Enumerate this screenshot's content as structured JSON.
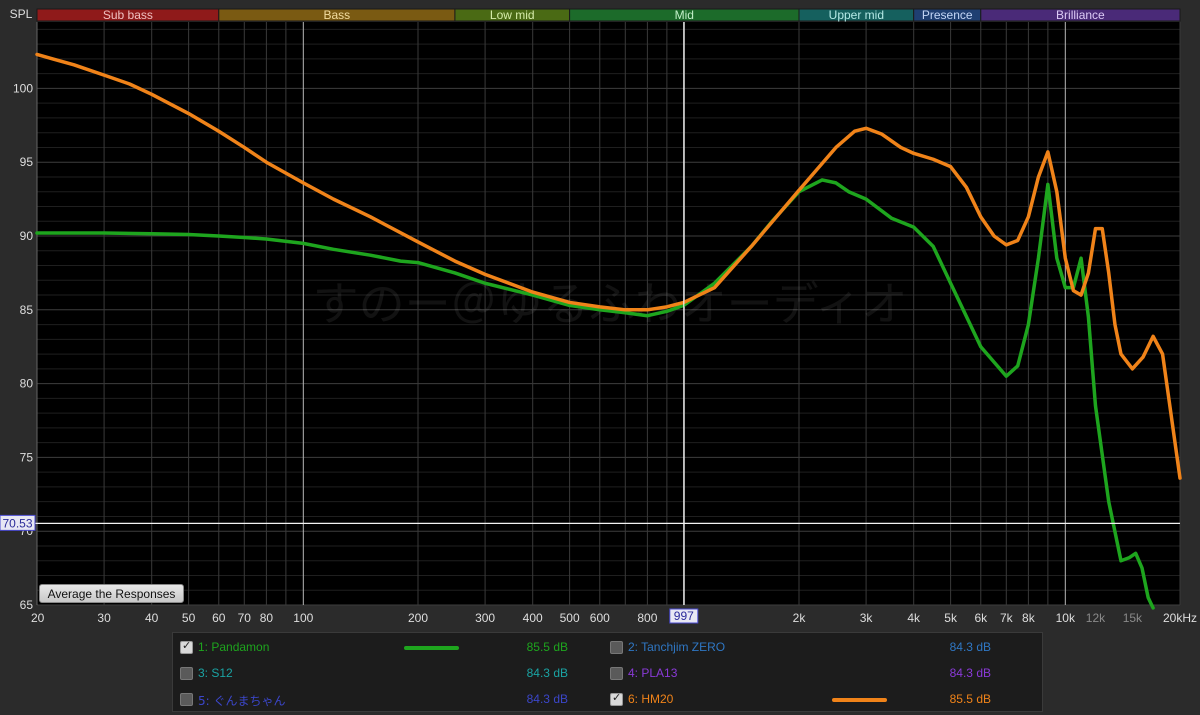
{
  "chart_data": {
    "type": "line",
    "ylabel": "SPL",
    "x_scale": "log",
    "xlim": [
      20,
      20000
    ],
    "ylim": [
      65,
      104.5
    ],
    "y_ticks": [
      100,
      95,
      90,
      85,
      80,
      75,
      70,
      65
    ],
    "x_ticks": [
      {
        "v": 20,
        "label": "20"
      },
      {
        "v": 30,
        "label": "30"
      },
      {
        "v": 40,
        "label": "40"
      },
      {
        "v": 50,
        "label": "50"
      },
      {
        "v": 60,
        "label": "60"
      },
      {
        "v": 70,
        "label": "70"
      },
      {
        "v": 80,
        "label": "80"
      },
      {
        "v": 100,
        "label": "100"
      },
      {
        "v": 200,
        "label": "200"
      },
      {
        "v": 300,
        "label": "300"
      },
      {
        "v": 400,
        "label": "400"
      },
      {
        "v": 500,
        "label": "500"
      },
      {
        "v": 600,
        "label": "600"
      },
      {
        "v": 800,
        "label": "800"
      },
      {
        "v": 2000,
        "label": "2k"
      },
      {
        "v": 3000,
        "label": "3k"
      },
      {
        "v": 4000,
        "label": "4k"
      },
      {
        "v": 5000,
        "label": "5k"
      },
      {
        "v": 6000,
        "label": "6k"
      },
      {
        "v": 7000,
        "label": "7k"
      },
      {
        "v": 8000,
        "label": "8k"
      },
      {
        "v": 10000,
        "label": "10k"
      },
      {
        "v": 12000,
        "label": "12k",
        "dim": true
      },
      {
        "v": 15000,
        "label": "15k",
        "dim": true
      },
      {
        "v": 20000,
        "label": "20kHz"
      }
    ],
    "bands": [
      {
        "label": "Sub bass",
        "from": 20,
        "to": 60,
        "bg": "#8f1a1a",
        "fg": "#f0c0c0"
      },
      {
        "label": "Bass",
        "from": 60,
        "to": 250,
        "bg": "#7a5a12",
        "fg": "#f2dca0"
      },
      {
        "label": "Low mid",
        "from": 250,
        "to": 500,
        "bg": "#4a6a14",
        "fg": "#d6ecaa"
      },
      {
        "label": "Mid",
        "from": 500,
        "to": 2000,
        "bg": "#1c6b2a",
        "fg": "#c2efc8"
      },
      {
        "label": "Upper mid",
        "from": 2000,
        "to": 4000,
        "bg": "#15605e",
        "fg": "#b4e9e6"
      },
      {
        "label": "Presence",
        "from": 4000,
        "to": 6000,
        "bg": "#1f3f72",
        "fg": "#c4d6f6"
      },
      {
        "label": "Brilliance",
        "from": 6000,
        "to": 20000,
        "bg": "#4a2a78",
        "fg": "#dccaf6"
      }
    ],
    "cursor": {
      "x": 997,
      "x_label": "997",
      "y": 70.53,
      "y_label": "70.53"
    },
    "watermark": "すのー＠ゆるふわオーディオ",
    "series": [
      {
        "name": "Pandamon",
        "color": "#1ea51e",
        "points": [
          [
            20,
            90.2
          ],
          [
            25,
            90.2
          ],
          [
            30,
            90.2
          ],
          [
            40,
            90.15
          ],
          [
            50,
            90.1
          ],
          [
            60,
            90.0
          ],
          [
            70,
            89.9
          ],
          [
            80,
            89.8
          ],
          [
            100,
            89.5
          ],
          [
            120,
            89.1
          ],
          [
            150,
            88.7
          ],
          [
            180,
            88.3
          ],
          [
            200,
            88.2
          ],
          [
            250,
            87.5
          ],
          [
            300,
            86.8
          ],
          [
            400,
            86.0
          ],
          [
            500,
            85.3
          ],
          [
            600,
            85.0
          ],
          [
            700,
            84.8
          ],
          [
            800,
            84.6
          ],
          [
            900,
            84.9
          ],
          [
            997,
            85.3
          ],
          [
            1200,
            86.8
          ],
          [
            1500,
            89.3
          ],
          [
            1700,
            91.0
          ],
          [
            2000,
            93.0
          ],
          [
            2300,
            93.8
          ],
          [
            2500,
            93.6
          ],
          [
            2700,
            93.0
          ],
          [
            3000,
            92.5
          ],
          [
            3500,
            91.2
          ],
          [
            4000,
            90.6
          ],
          [
            4500,
            89.3
          ],
          [
            5000,
            86.8
          ],
          [
            6000,
            82.5
          ],
          [
            7000,
            80.5
          ],
          [
            7500,
            81.2
          ],
          [
            8000,
            84.0
          ],
          [
            8500,
            88.5
          ],
          [
            9000,
            93.5
          ],
          [
            9500,
            88.5
          ],
          [
            10000,
            86.5
          ],
          [
            10500,
            86.5
          ],
          [
            11000,
            88.5
          ],
          [
            11500,
            84.5
          ],
          [
            12000,
            78.5
          ],
          [
            13000,
            72.0
          ],
          [
            14000,
            68.0
          ],
          [
            14700,
            68.2
          ],
          [
            15300,
            68.5
          ],
          [
            15900,
            67.5
          ],
          [
            16500,
            65.5
          ],
          [
            17000,
            64.8
          ]
        ]
      },
      {
        "name": "HM20",
        "color": "#f08319",
        "points": [
          [
            20,
            102.3
          ],
          [
            22,
            102.0
          ],
          [
            25,
            101.6
          ],
          [
            30,
            100.9
          ],
          [
            35,
            100.3
          ],
          [
            40,
            99.6
          ],
          [
            50,
            98.3
          ],
          [
            60,
            97.1
          ],
          [
            70,
            96.0
          ],
          [
            80,
            95.0
          ],
          [
            100,
            93.6
          ],
          [
            120,
            92.5
          ],
          [
            150,
            91.3
          ],
          [
            200,
            89.6
          ],
          [
            250,
            88.3
          ],
          [
            300,
            87.4
          ],
          [
            400,
            86.2
          ],
          [
            500,
            85.5
          ],
          [
            600,
            85.2
          ],
          [
            700,
            85.0
          ],
          [
            800,
            85.0
          ],
          [
            900,
            85.2
          ],
          [
            997,
            85.5
          ],
          [
            1200,
            86.5
          ],
          [
            1500,
            89.3
          ],
          [
            2000,
            93.1
          ],
          [
            2500,
            96.0
          ],
          [
            2800,
            97.1
          ],
          [
            3000,
            97.3
          ],
          [
            3300,
            96.9
          ],
          [
            3700,
            96.0
          ],
          [
            4000,
            95.6
          ],
          [
            4500,
            95.2
          ],
          [
            5000,
            94.7
          ],
          [
            5500,
            93.3
          ],
          [
            6000,
            91.3
          ],
          [
            6500,
            90.0
          ],
          [
            7000,
            89.4
          ],
          [
            7500,
            89.7
          ],
          [
            8000,
            91.3
          ],
          [
            8500,
            94.0
          ],
          [
            9000,
            95.7
          ],
          [
            9500,
            93.0
          ],
          [
            10000,
            88.5
          ],
          [
            10500,
            86.3
          ],
          [
            11000,
            86.0
          ],
          [
            11500,
            87.5
          ],
          [
            12000,
            90.5
          ],
          [
            12500,
            90.5
          ],
          [
            13000,
            87.5
          ],
          [
            13500,
            84.0
          ],
          [
            14000,
            82.0
          ],
          [
            15000,
            81.0
          ],
          [
            16000,
            81.8
          ],
          [
            17000,
            83.2
          ],
          [
            18000,
            82.0
          ],
          [
            20000,
            73.6
          ]
        ]
      }
    ]
  },
  "controls": {
    "average_label": "Average the Responses"
  },
  "legend": [
    {
      "id": "1",
      "name": "Pandamon",
      "label": "1: Pandamon",
      "checked": true,
      "color": "#1ea51e",
      "value": "85.5 dB",
      "show_swatch": true
    },
    {
      "id": "2",
      "name": "Tanchjim ZERO",
      "label": "2: Tanchjim ZERO",
      "checked": false,
      "color": "#2f77c4",
      "value": "84.3 dB",
      "show_swatch": false
    },
    {
      "id": "3",
      "name": "S12",
      "label": "3: S12",
      "checked": false,
      "color": "#1aa3a3",
      "value": "84.3 dB",
      "show_swatch": false
    },
    {
      "id": "4",
      "name": "PLA13",
      "label": "4: PLA13",
      "checked": false,
      "color": "#8a3ad8",
      "value": "84.3 dB",
      "show_swatch": false
    },
    {
      "id": "5",
      "name": "ぐんまちゃん",
      "label": "5: ぐんまちゃん",
      "checked": false,
      "color": "#3b46c9",
      "value": "84.3 dB",
      "show_swatch": false
    },
    {
      "id": "6",
      "name": "HM20",
      "label": "6: HM20",
      "checked": true,
      "color": "#f08319",
      "value": "85.5 dB",
      "show_swatch": true
    }
  ]
}
